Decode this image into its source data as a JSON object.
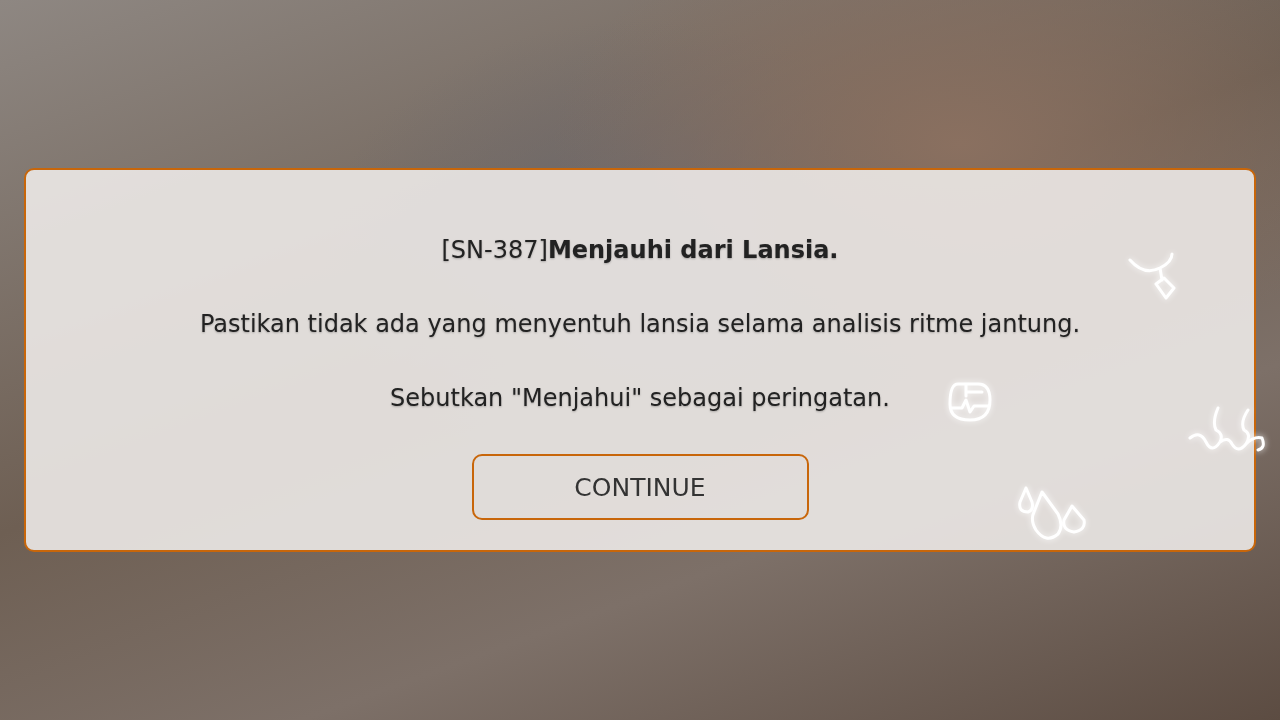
{
  "dialog": {
    "title": "[SN-387]**Menjauhi dari Lansia.**",
    "paragraphs": [
      "Pastikan tidak ada yang menyentuh lansia selama analisis ritme jantung.",
      "Sebutkan \"Menjahui\" sebagai peringatan."
    ],
    "button": "CONTINUE"
  }
}
